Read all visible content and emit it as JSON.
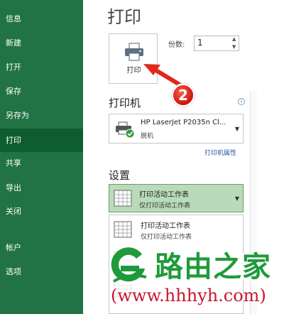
{
  "sidebar": {
    "items": [
      {
        "label": "信息"
      },
      {
        "label": "新建"
      },
      {
        "label": "打开"
      },
      {
        "label": "保存"
      },
      {
        "label": "另存为"
      },
      {
        "label": "打印",
        "active": true
      },
      {
        "label": "共享"
      },
      {
        "label": "导出"
      },
      {
        "label": "关闭"
      },
      {
        "label": "帐户"
      },
      {
        "label": "选项"
      }
    ],
    "color": "#217346",
    "active_color": "#0e5c2f"
  },
  "main": {
    "title": "打印",
    "print_button_label": "打印",
    "copies_label": "份数:",
    "copies_value": "1",
    "step_number": "2",
    "printer_section_title": "打印机",
    "printer_name": "HP LaserJet P2035n Cl...",
    "printer_status": "脱机",
    "printer_properties_link": "打印机属性",
    "settings_section_title": "设置",
    "setting_selected": {
      "main": "打印活动工作表",
      "sub": "仅打印活动工作表"
    },
    "dropdown_options": [
      {
        "main": "打印活动工作表",
        "sub": "仅打印活动工作表"
      }
    ],
    "info_icon_glyph": "i"
  },
  "watermark": {
    "brand": "路由之家",
    "url": "(www.hhhyh.com)",
    "color_green": "#1f9a3b",
    "color_red": "#c9162d"
  }
}
